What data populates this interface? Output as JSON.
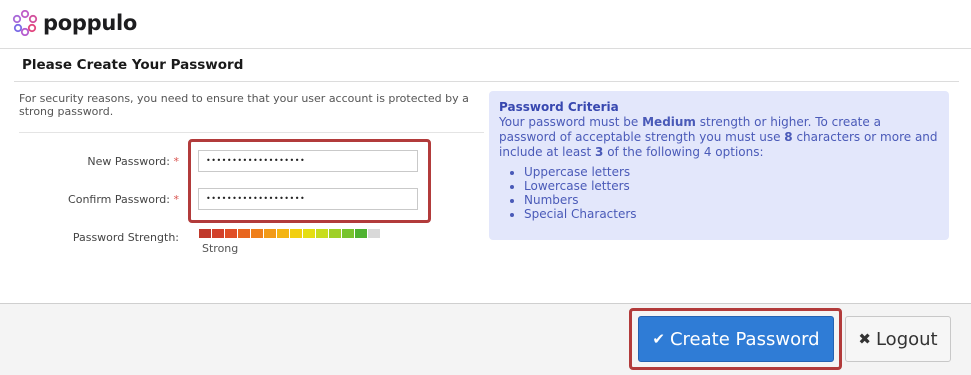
{
  "brand": {
    "name": "poppulo"
  },
  "page": {
    "title": "Please Create Your Password"
  },
  "intro": {
    "text": "For security reasons, you need to ensure that your user account is protected by a strong password."
  },
  "form": {
    "new_password": {
      "label": "New Password:",
      "required_mark": "*",
      "value": "•••••••••••••••••••"
    },
    "confirm_password": {
      "label": "Confirm Password:",
      "required_mark": "*",
      "value": "•••••••••••••••••••"
    },
    "strength": {
      "label": "Password Strength:",
      "text": "Strong",
      "level": 13,
      "max": 14,
      "colors": [
        "#c0392b",
        "#d2402a",
        "#e04e26",
        "#e8661f",
        "#ef7f1a",
        "#f29a17",
        "#f4b513",
        "#f2cf10",
        "#e5de12",
        "#c7dd1e",
        "#9fd027",
        "#78c42e",
        "#4fb231",
        "#d9d9d9"
      ]
    }
  },
  "criteria": {
    "title": "Password Criteria",
    "text_1": "Your password must be ",
    "strength_word": "Medium",
    "text_2": " strength or higher. To create a password of acceptable strength you must use ",
    "min_chars": "8",
    "text_3": " characters or more and include at least ",
    "min_options": "3",
    "text_4": " of the following 4 options:",
    "options": [
      "Uppercase letters",
      "Lowercase letters",
      "Numbers",
      "Special Characters"
    ]
  },
  "buttons": {
    "create_icon": "✔",
    "create_label": "Create Password",
    "logout_icon": "✖",
    "logout_label": "Logout"
  },
  "colors": {
    "primary": "#2f7cd6",
    "highlight": "#b23b3b",
    "criteria_bg": "#e3e7fb"
  }
}
